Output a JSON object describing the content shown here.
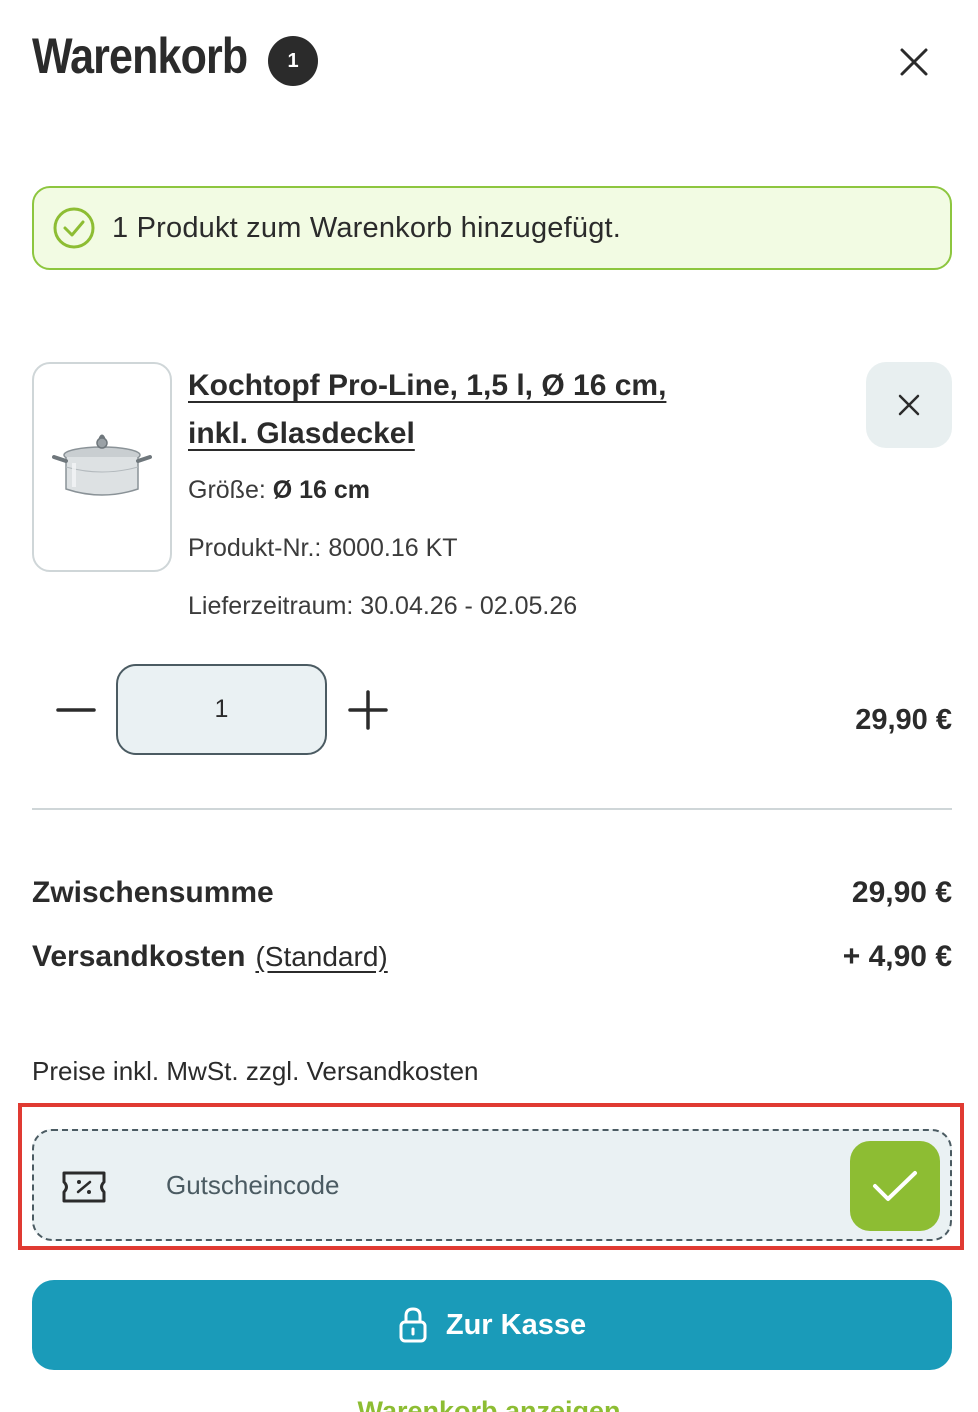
{
  "header": {
    "title": "Warenkorb",
    "badge_count": "1"
  },
  "notice": {
    "text": "1 Produkt zum Warenkorb hinzugefügt."
  },
  "item": {
    "title": "Kochtopf Pro-Line, 1,5 l, Ø 16 cm, inkl. Glasdeckel",
    "size_label": "Größe:",
    "size_value": "Ø 16 cm",
    "product_number": "Produkt-Nr.: 8000.16 KT",
    "delivery": "Lieferzeitraum: 30.04.26 - 02.05.26",
    "quantity": "1",
    "price": "29,90 €"
  },
  "summary": {
    "subtotal_label": "Zwischensumme",
    "subtotal_value": "29,90 €",
    "shipping_label": "Versandkosten",
    "shipping_type": "(Standard)",
    "shipping_value": "+ 4,90 €",
    "vat_note": "Preise inkl. MwSt. zzgl. Versandkosten"
  },
  "coupon": {
    "placeholder": "Gutscheincode"
  },
  "checkout": {
    "label": "Zur Kasse"
  },
  "view_cart": {
    "label": "Warenkorb anzeigen"
  },
  "colors": {
    "accent_green": "#8dbd33",
    "notice_bg": "#f2fbe3",
    "checkout_blue": "#1a9bb9",
    "highlight_red": "#e03a32",
    "text_dark": "#2b2b2b"
  }
}
